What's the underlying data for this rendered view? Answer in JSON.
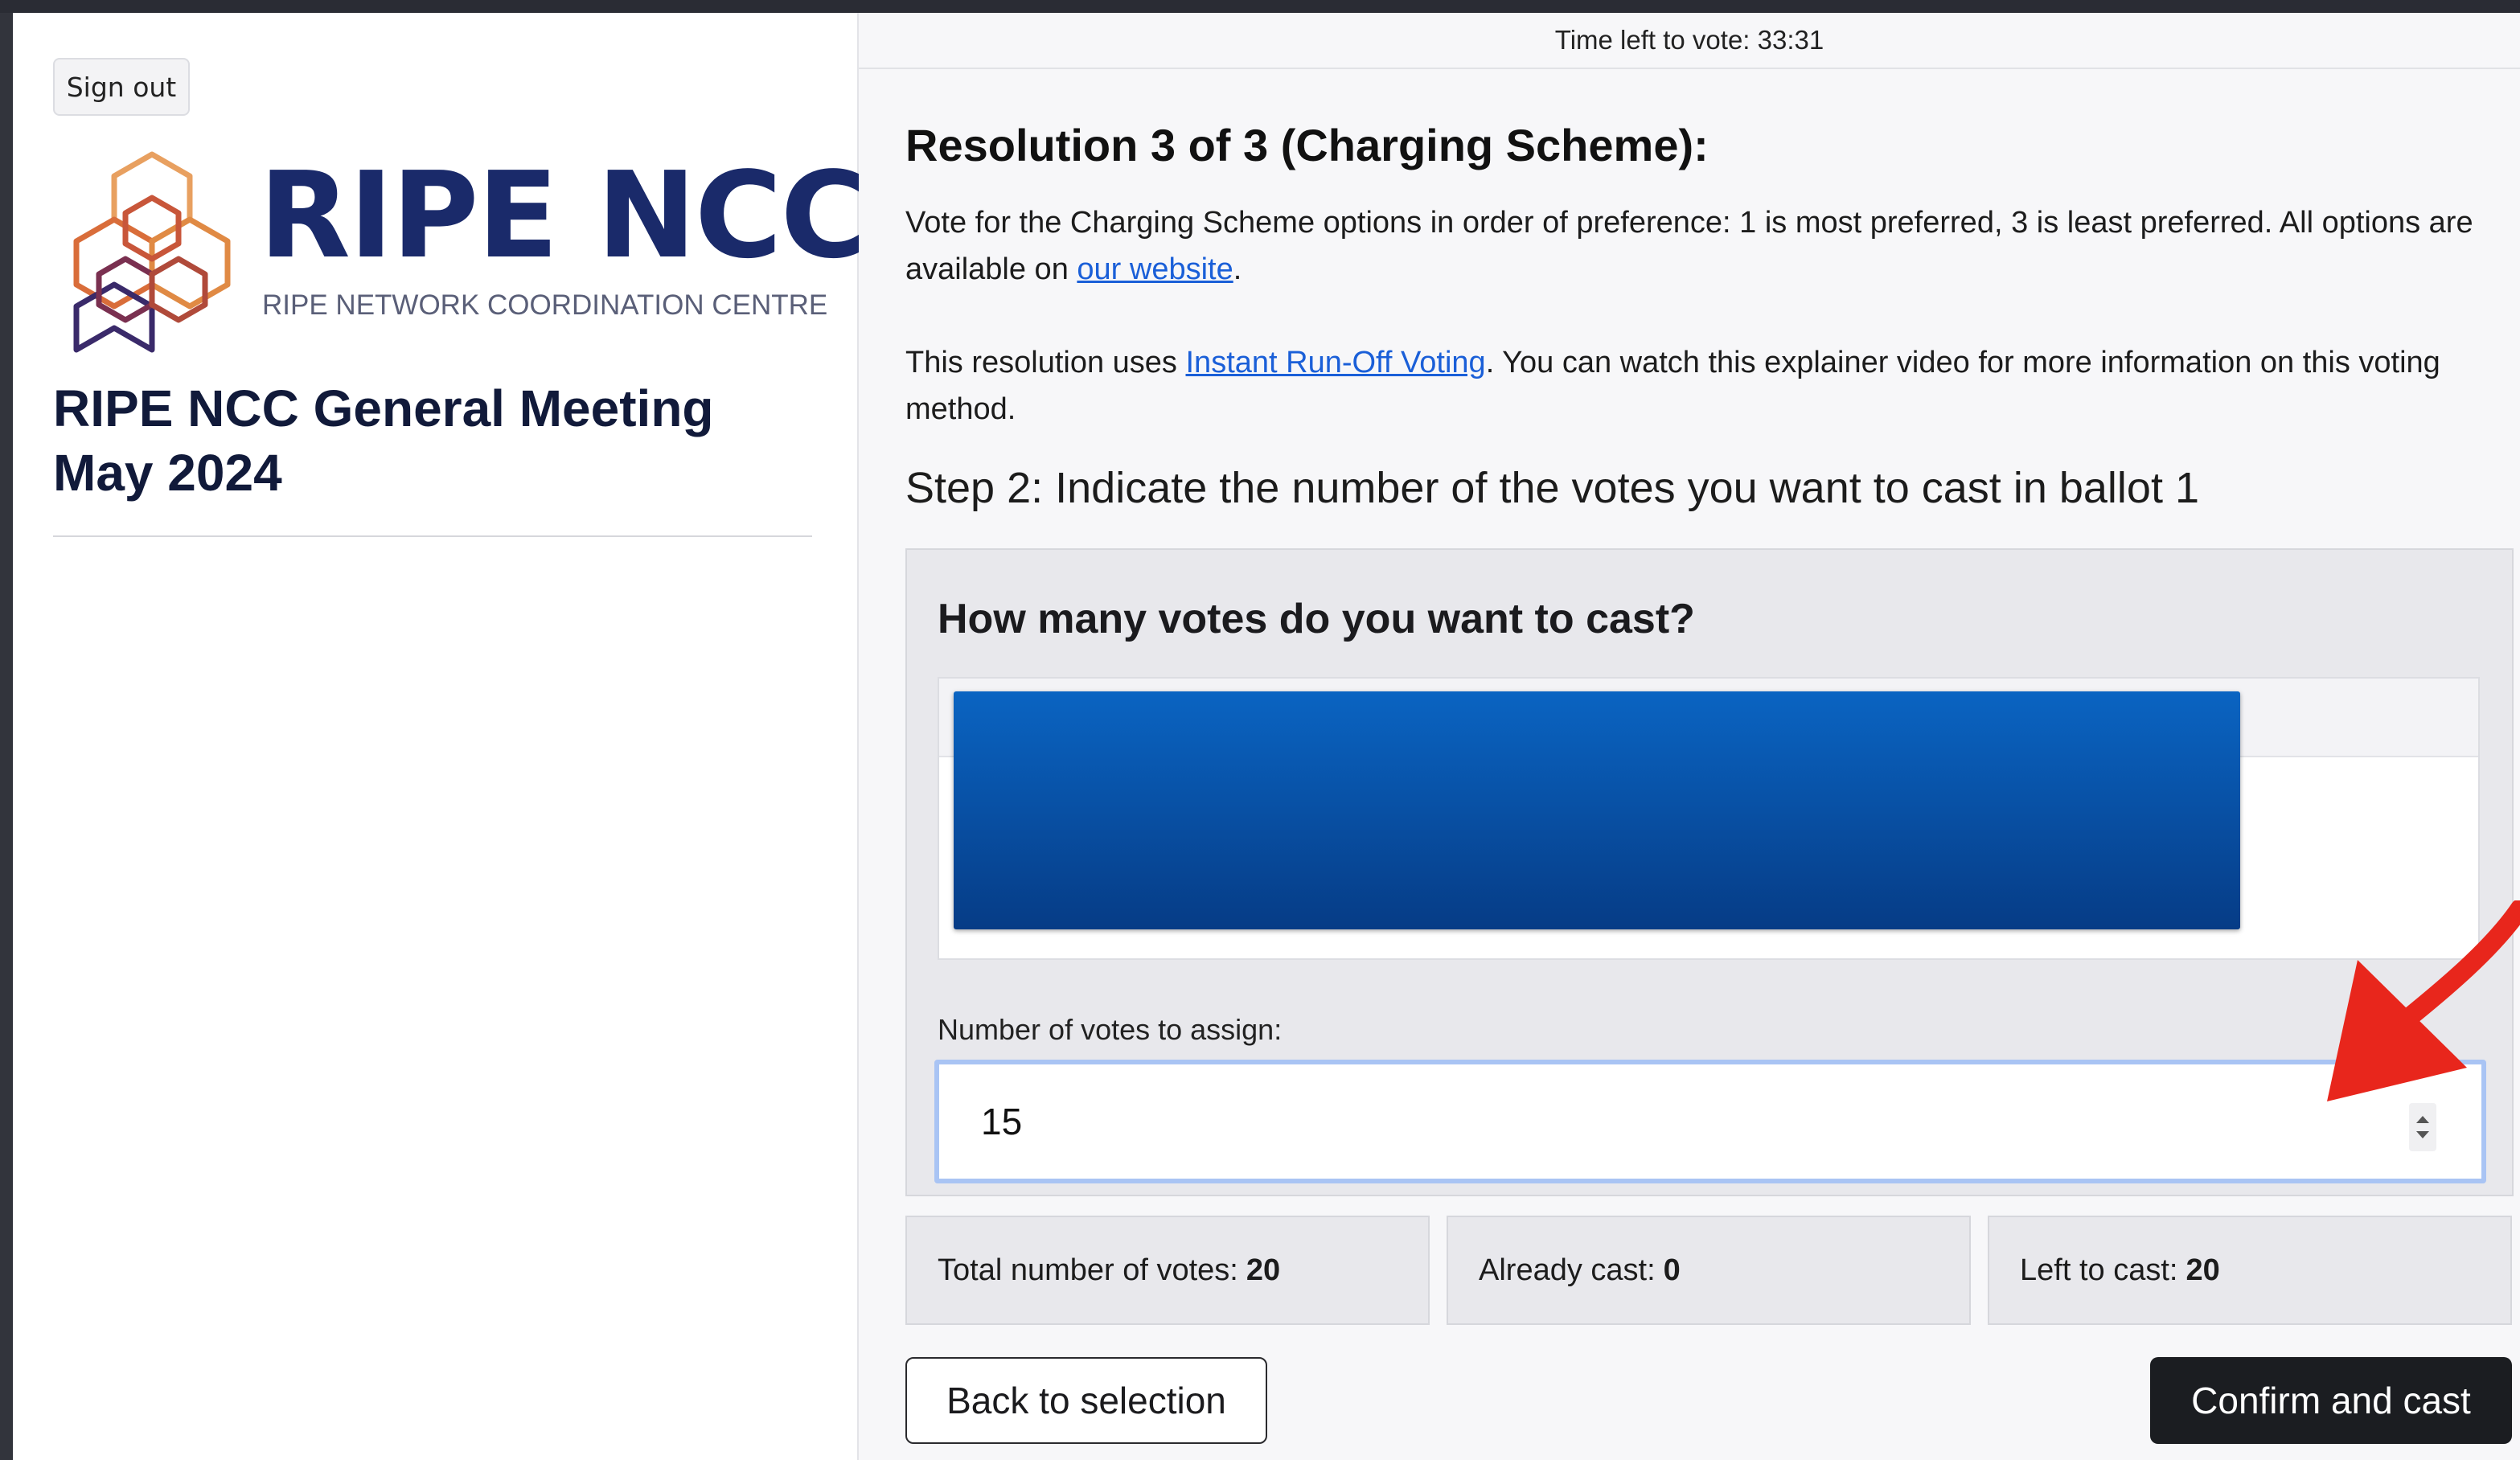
{
  "sidebar": {
    "signout_label": "Sign out",
    "logo": {
      "title": "RIPE NCC",
      "subtitle": "RIPE NETWORK COORDINATION CENTRE"
    },
    "meeting_title": "RIPE NCC General Meeting May 2024"
  },
  "header": {
    "timer_text": "Time left to vote: 33:31"
  },
  "resolution": {
    "title": "Resolution 3 of 3 (Charging Scheme):",
    "intro_text": "Vote for the Charging Scheme options in order of preference: 1 is most preferred, 3 is least preferred. All options are available on ",
    "intro_link": "our website",
    "intro_end": ".",
    "irv_text_before": "This resolution uses ",
    "irv_link": "Instant Run-Off Voting",
    "irv_text_after": ". You can watch this explainer video for more information on this voting method."
  },
  "step": {
    "title": "Step 2: Indicate the number of the votes you want to cast in ballot 1"
  },
  "vote_panel": {
    "title": "How many votes do you want to cast?",
    "input_label": "Number of votes to assign:",
    "input_value": "15"
  },
  "stats": {
    "total_label": "Total number of votes:",
    "total_value": "20",
    "cast_label": "Already cast:",
    "cast_value": "0",
    "left_label": "Left to cast:",
    "left_value": "20"
  },
  "actions": {
    "back_label": "Back to selection",
    "confirm_label": "Confirm and cast"
  },
  "colors": {
    "brand_navy": "#1a2a6a",
    "link_blue": "#1a5fd8",
    "redaction_blue": "#0a5bb8",
    "annotation_red": "#e8261c",
    "confirm_button": "#1b1d21"
  }
}
